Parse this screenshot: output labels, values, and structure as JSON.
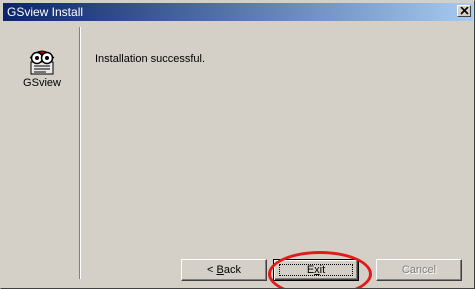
{
  "window": {
    "title": "GSview Install",
    "close_glyph": "×"
  },
  "sidebar": {
    "icon": "gsview-app-icon",
    "app_label": "GSview"
  },
  "main": {
    "message": "Installation successful."
  },
  "buttons": {
    "back_prefix": "< ",
    "back_mnemonic": "B",
    "back_rest": "ack",
    "exit_prefix": "E",
    "exit_mnemonic": "x",
    "exit_rest": "it",
    "cancel_label": "Cancel"
  },
  "colors": {
    "titlebar_start": "#0a246a",
    "titlebar_end": "#a6caf0",
    "dialog_face": "#d4d0c8",
    "highlight_ring": "#e21a1a"
  }
}
